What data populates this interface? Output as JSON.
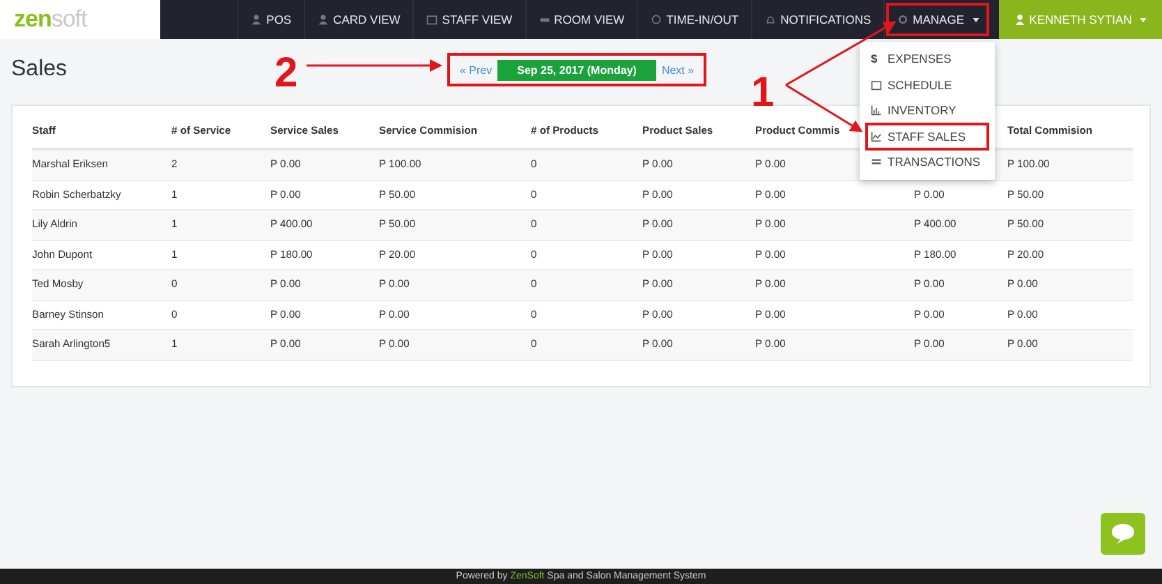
{
  "logo": {
    "part_1": "zen",
    "part_2": "soft"
  },
  "nav": [
    {
      "label": "POS"
    },
    {
      "label": "CARD VIEW"
    },
    {
      "label": "STAFF VIEW"
    },
    {
      "label": "ROOM VIEW"
    },
    {
      "label": "TIME-IN/OUT"
    },
    {
      "label": "NOTIFICATIONS"
    }
  ],
  "manage": {
    "label": "MANAGE",
    "expanded": true,
    "highlighted": true,
    "menu": [
      {
        "symbol": "$",
        "label": "EXPENSES",
        "highlighted": false
      },
      {
        "label": "SCHEDULE",
        "highlighted": false
      },
      {
        "label": "INVENTORY",
        "highlighted": false
      },
      {
        "label": "STAFF SALES",
        "highlighted": true
      },
      {
        "label": "TRANSACTIONS",
        "highlighted": false
      }
    ]
  },
  "user": {
    "name": "KENNETH SYTIAN"
  },
  "page_title": "Sales",
  "date_nav": {
    "prev": "« Prev",
    "date": "Sep 25, 2017 (Monday)",
    "next": "Next »",
    "highlighted": true
  },
  "table": {
    "columns": [
      "Staff",
      "# of Service",
      "Service Sales",
      "Service Commision",
      "# of Products",
      "Product Sales",
      "Product Commis",
      null,
      "Total Commision"
    ],
    "rows": [
      [
        "Marshal Eriksen",
        "2",
        "P 0.00",
        "P 100.00",
        "0",
        "P 0.00",
        "P 0.00",
        null,
        "P 100.00"
      ],
      [
        "Robin Scherbatzky",
        "1",
        "P 0.00",
        "P 50.00",
        "0",
        "P 0.00",
        "P 0.00",
        "P 0.00",
        "P 50.00"
      ],
      [
        "Lily Aldrin",
        "1",
        "P 400.00",
        "P 50.00",
        "0",
        "P 0.00",
        "P 0.00",
        "P 400.00",
        "P 50.00"
      ],
      [
        "John Dupont",
        "1",
        "P 180.00",
        "P 20.00",
        "0",
        "P 0.00",
        "P 0.00",
        "P 180.00",
        "P 20.00"
      ],
      [
        "Ted Mosby",
        "0",
        "P 0.00",
        "P 0.00",
        "0",
        "P 0.00",
        "P 0.00",
        "P 0.00",
        "P 0.00"
      ],
      [
        "Barney Stinson",
        "0",
        "P 0.00",
        "P 0.00",
        "0",
        "P 0.00",
        "P 0.00",
        "P 0.00",
        "P 0.00"
      ],
      [
        "Sarah Arlington5",
        "1",
        "P 0.00",
        "P 0.00",
        "0",
        "P 0.00",
        "P 0.00",
        "P 0.00",
        "P 0.00"
      ]
    ]
  },
  "footer": {
    "prefix": "Powered by",
    "brand": "ZenSoft",
    "suffix": "Spa and Salon Management System"
  },
  "annotations": [
    {
      "label": "2"
    },
    {
      "label": "1"
    }
  ]
}
